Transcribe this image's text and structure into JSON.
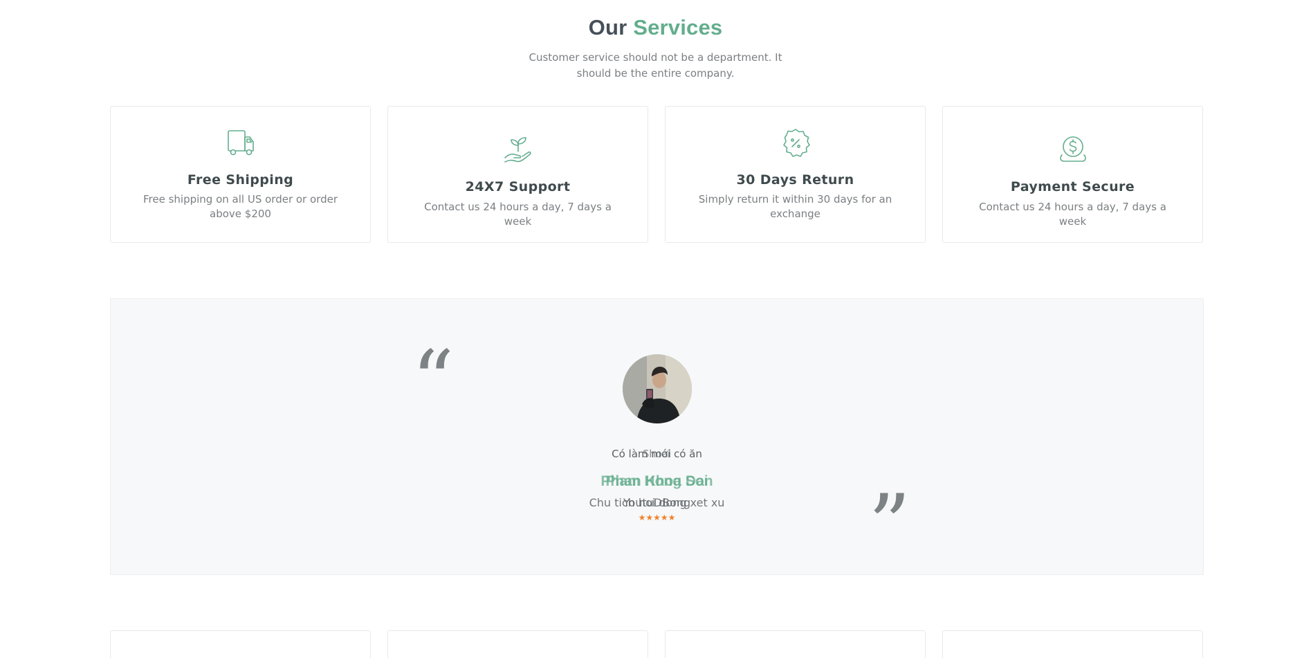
{
  "header": {
    "title_part1": "Our",
    "title_part2": "Services",
    "subtitle": "Customer service should not be a department. It should be the entire company."
  },
  "services": [
    {
      "icon": "truck-icon",
      "title": "Free Shipping",
      "description": "Free shipping on all US order or order above $200"
    },
    {
      "icon": "hand-plant-icon",
      "title": "24X7 Support",
      "description": "Contact us 24 hours a day, 7 days a week"
    },
    {
      "icon": "percent-badge-icon",
      "title": "30 Days Return",
      "description": "Simply return it within 30 days for an exchange"
    },
    {
      "icon": "dollar-coin-hand-icon",
      "title": "Payment Secure",
      "description": "Contact us 24 hours a day, 7 days a week"
    }
  ],
  "testimonials": [
    {
      "message": "Có làm mới có ăn",
      "name": "Pham Hong Son",
      "role": "Chu tich hoi dong xet xu"
    },
    {
      "message": "Shoai",
      "name": "Phan Khoa Dai",
      "role": "YoutuDBong"
    }
  ],
  "rating": {
    "stars": "★★★★★",
    "value": 5,
    "max": 5
  },
  "colors": {
    "accent": "#63ad8d",
    "text": "#3f4a4d",
    "muted": "#7b7f82",
    "star": "#f0822a",
    "panel": "#f7f8f9"
  },
  "icons": {
    "quote_open": "left-double-quote-icon",
    "quote_close": "right-double-quote-icon"
  }
}
